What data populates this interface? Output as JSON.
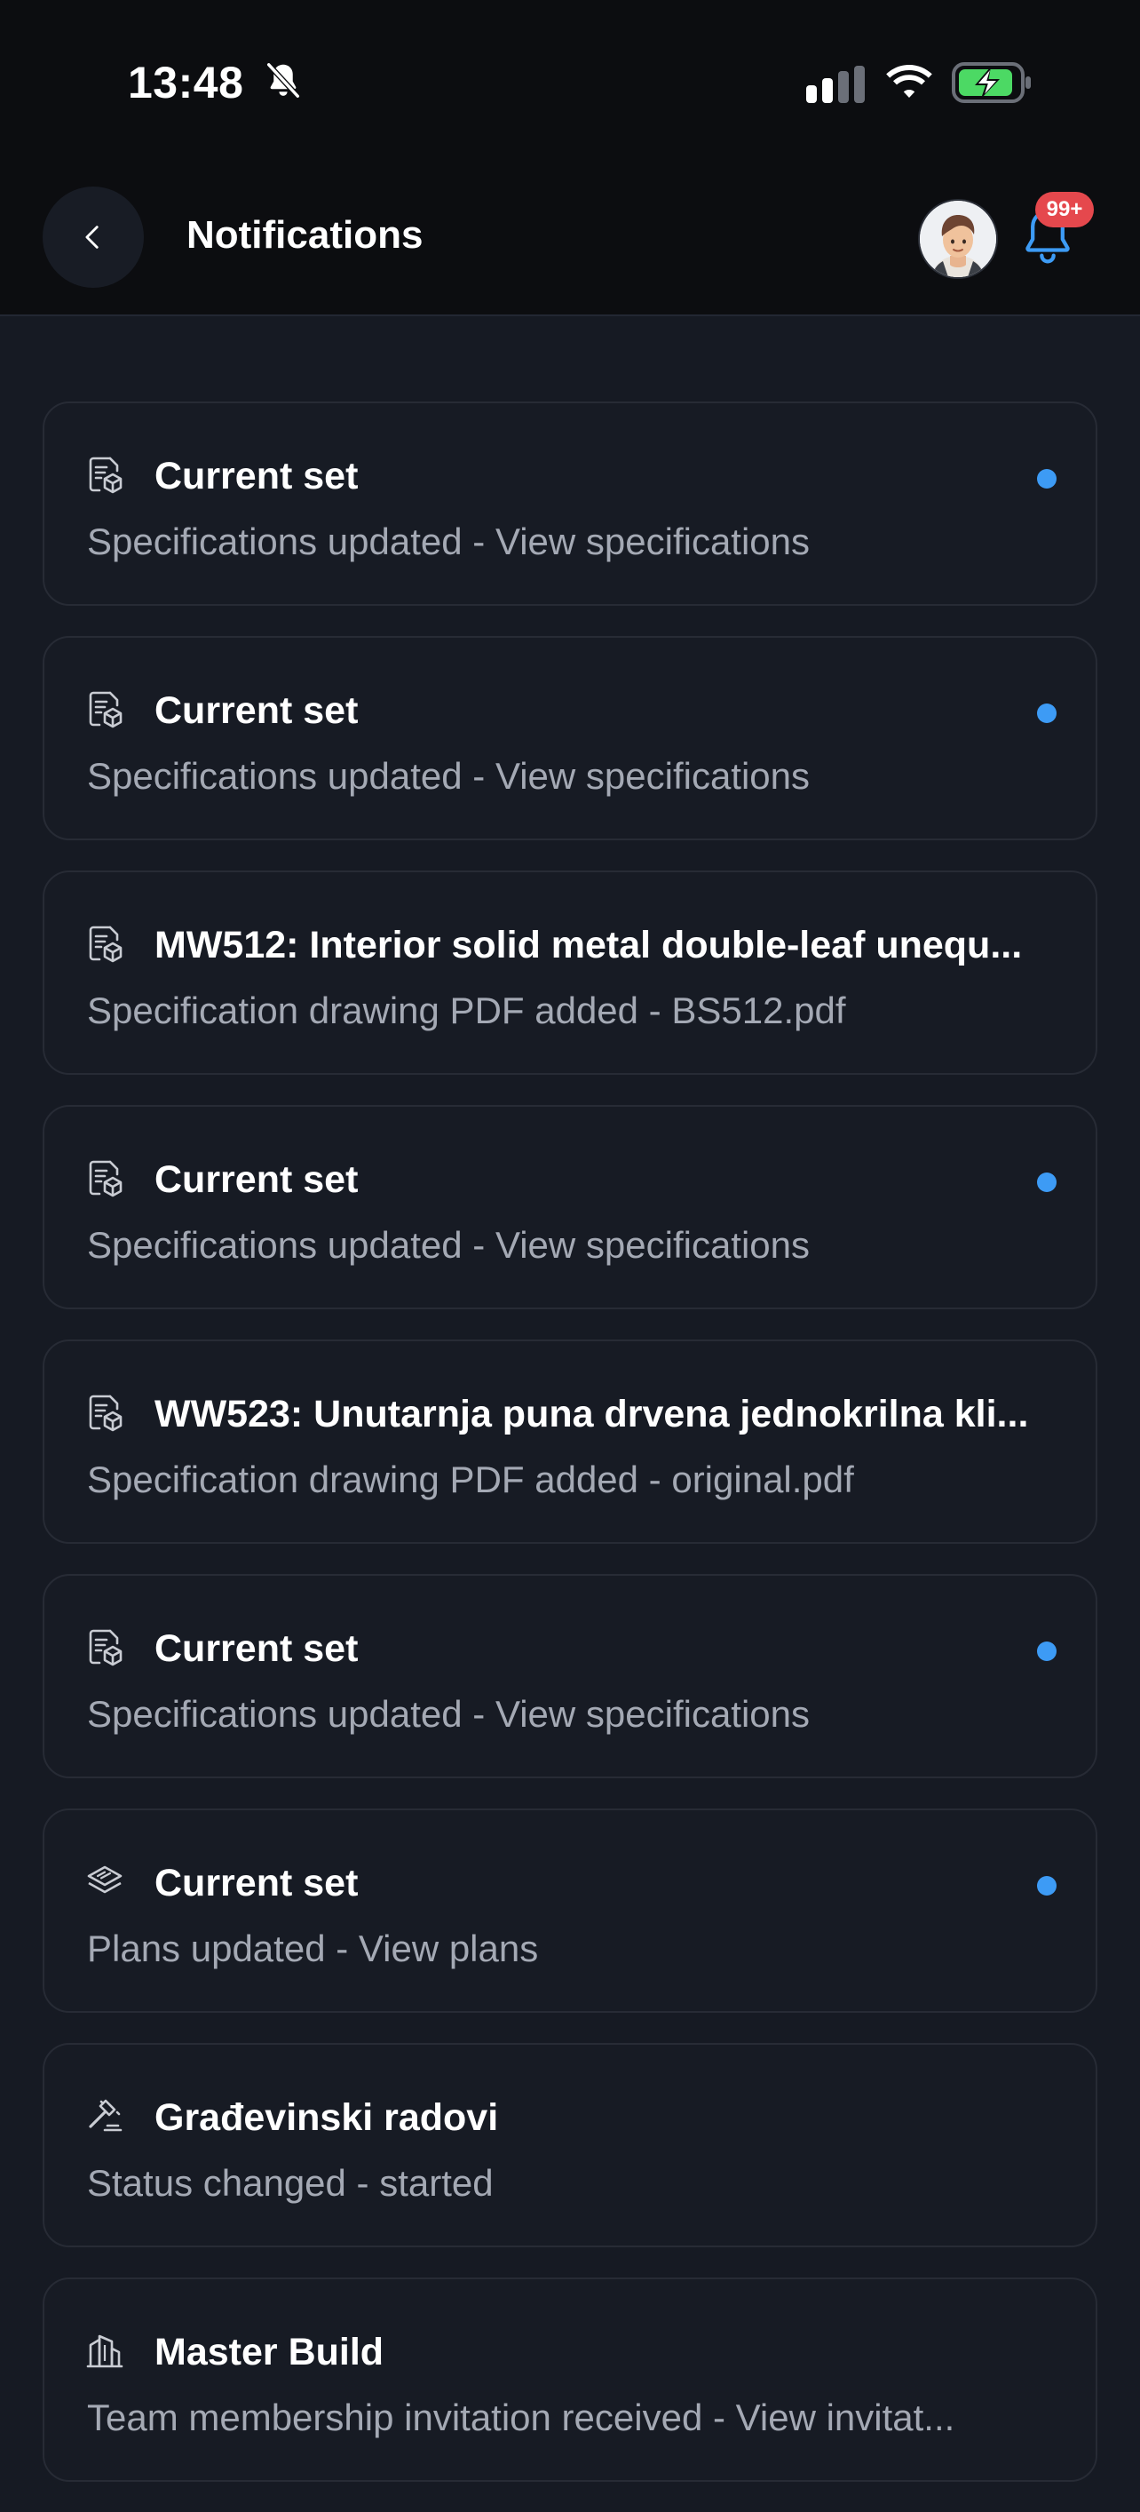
{
  "status_bar": {
    "time": "13:48",
    "icons": [
      "bell-slash-icon",
      "cellular-signal-icon",
      "wifi-icon",
      "battery-charging-icon"
    ]
  },
  "header": {
    "back_icon": "chevron-left-icon",
    "title": "Notifications",
    "avatar": "user-avatar",
    "bell_icon": "bell-icon",
    "badge": "99+"
  },
  "colors": {
    "background": "#161a23",
    "card": "#171b24",
    "unread_dot": "#3d9bf5",
    "badge": "#e5484d",
    "bell": "#3d9bf5",
    "battery": "#4cd964"
  },
  "notifications": [
    {
      "icon": "specification-doc-icon",
      "title": "Current set",
      "subtitle": "Specifications updated - View specifications",
      "unread": true
    },
    {
      "icon": "specification-doc-icon",
      "title": "Current set",
      "subtitle": "Specifications updated - View specifications",
      "unread": true
    },
    {
      "icon": "specification-doc-icon",
      "title": "MW512: Interior solid metal double-leaf unequ...",
      "subtitle": "Specification drawing PDF added - BS512.pdf",
      "unread": false
    },
    {
      "icon": "specification-doc-icon",
      "title": "Current set",
      "subtitle": "Specifications updated - View specifications",
      "unread": true
    },
    {
      "icon": "specification-doc-icon",
      "title": "WW523: Unutarnja puna drvena jednokrilna kli...",
      "subtitle": "Specification drawing PDF added - original.pdf",
      "unread": false
    },
    {
      "icon": "specification-doc-icon",
      "title": "Current set",
      "subtitle": "Specifications updated - View specifications",
      "unread": true
    },
    {
      "icon": "layers-icon",
      "title": "Current set",
      "subtitle": "Plans updated - View plans",
      "unread": true
    },
    {
      "icon": "gavel-icon",
      "title": "Građevinski radovi",
      "subtitle": "Status changed - started",
      "unread": false
    },
    {
      "icon": "buildings-icon",
      "title": "Master Build",
      "subtitle": "Team membership invitation received - View invitat...",
      "unread": false
    }
  ]
}
